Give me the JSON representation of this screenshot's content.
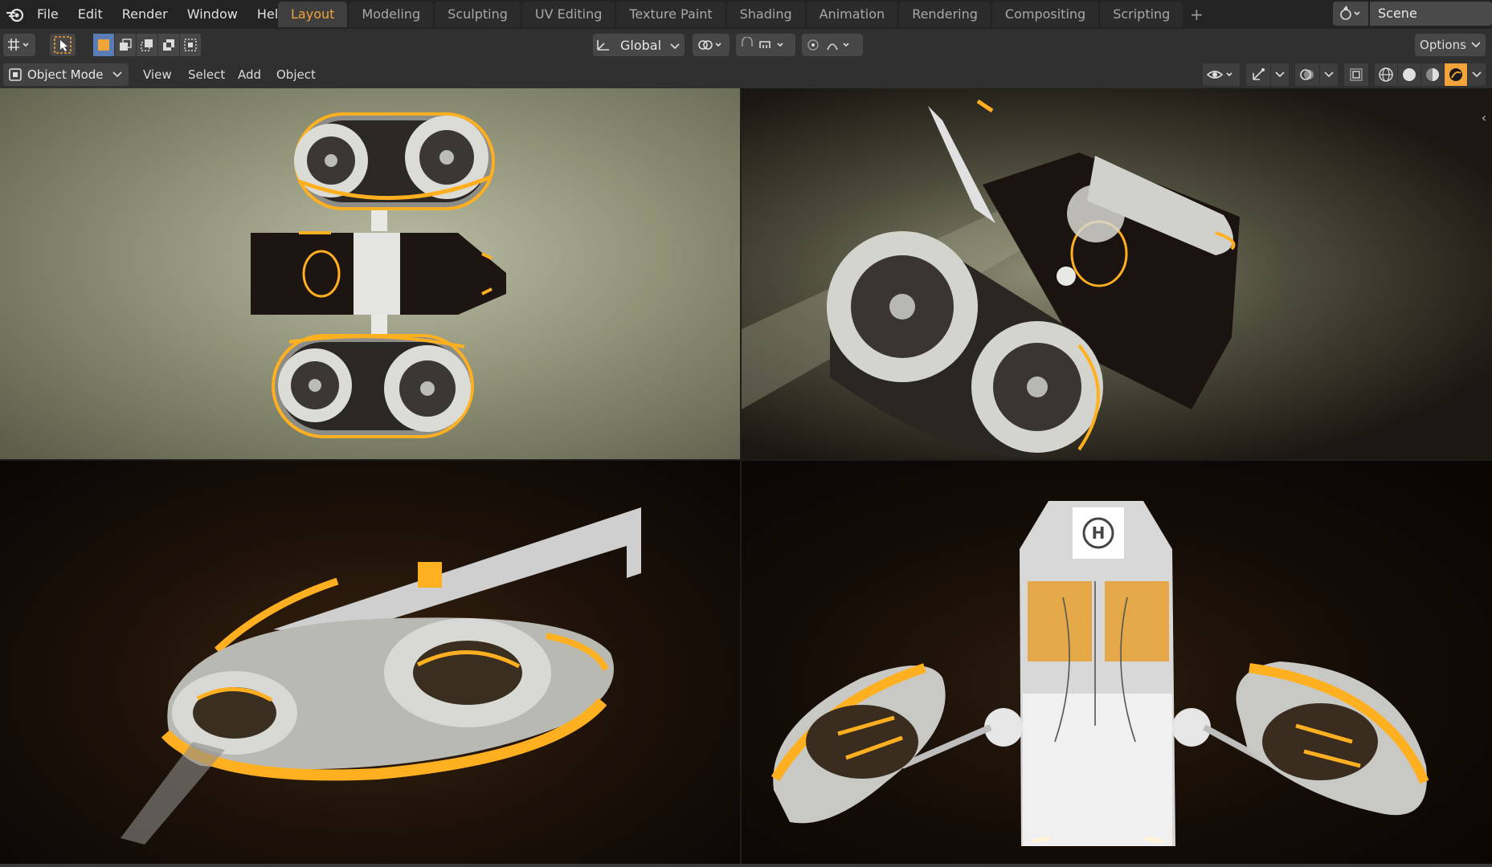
{
  "topbar": {
    "menus": [
      {
        "label": "File"
      },
      {
        "label": "Edit"
      },
      {
        "label": "Render"
      },
      {
        "label": "Window"
      },
      {
        "label": "Help"
      }
    ],
    "workspace_tabs": [
      {
        "label": "Layout",
        "active": true
      },
      {
        "label": "Modeling"
      },
      {
        "label": "Sculpting"
      },
      {
        "label": "UV Editing"
      },
      {
        "label": "Texture Paint"
      },
      {
        "label": "Shading"
      },
      {
        "label": "Animation"
      },
      {
        "label": "Rendering"
      },
      {
        "label": "Compositing"
      },
      {
        "label": "Scripting"
      }
    ],
    "add_tab_icon": "plus-icon",
    "scene_name": "Scene"
  },
  "toolbar": {
    "transform_orientation": "Global",
    "options_label": "Options"
  },
  "header": {
    "mode": "Object Mode",
    "menus": [
      {
        "label": "View"
      },
      {
        "label": "Select"
      },
      {
        "label": "Add"
      },
      {
        "label": "Object"
      }
    ],
    "shading_modes": [
      "wireframe",
      "solid",
      "material-preview",
      "rendered"
    ],
    "active_shading": "rendered"
  },
  "colors": {
    "accent": "#f0a43a",
    "glow": "#ffb020",
    "active_select": "#5a7db5"
  }
}
